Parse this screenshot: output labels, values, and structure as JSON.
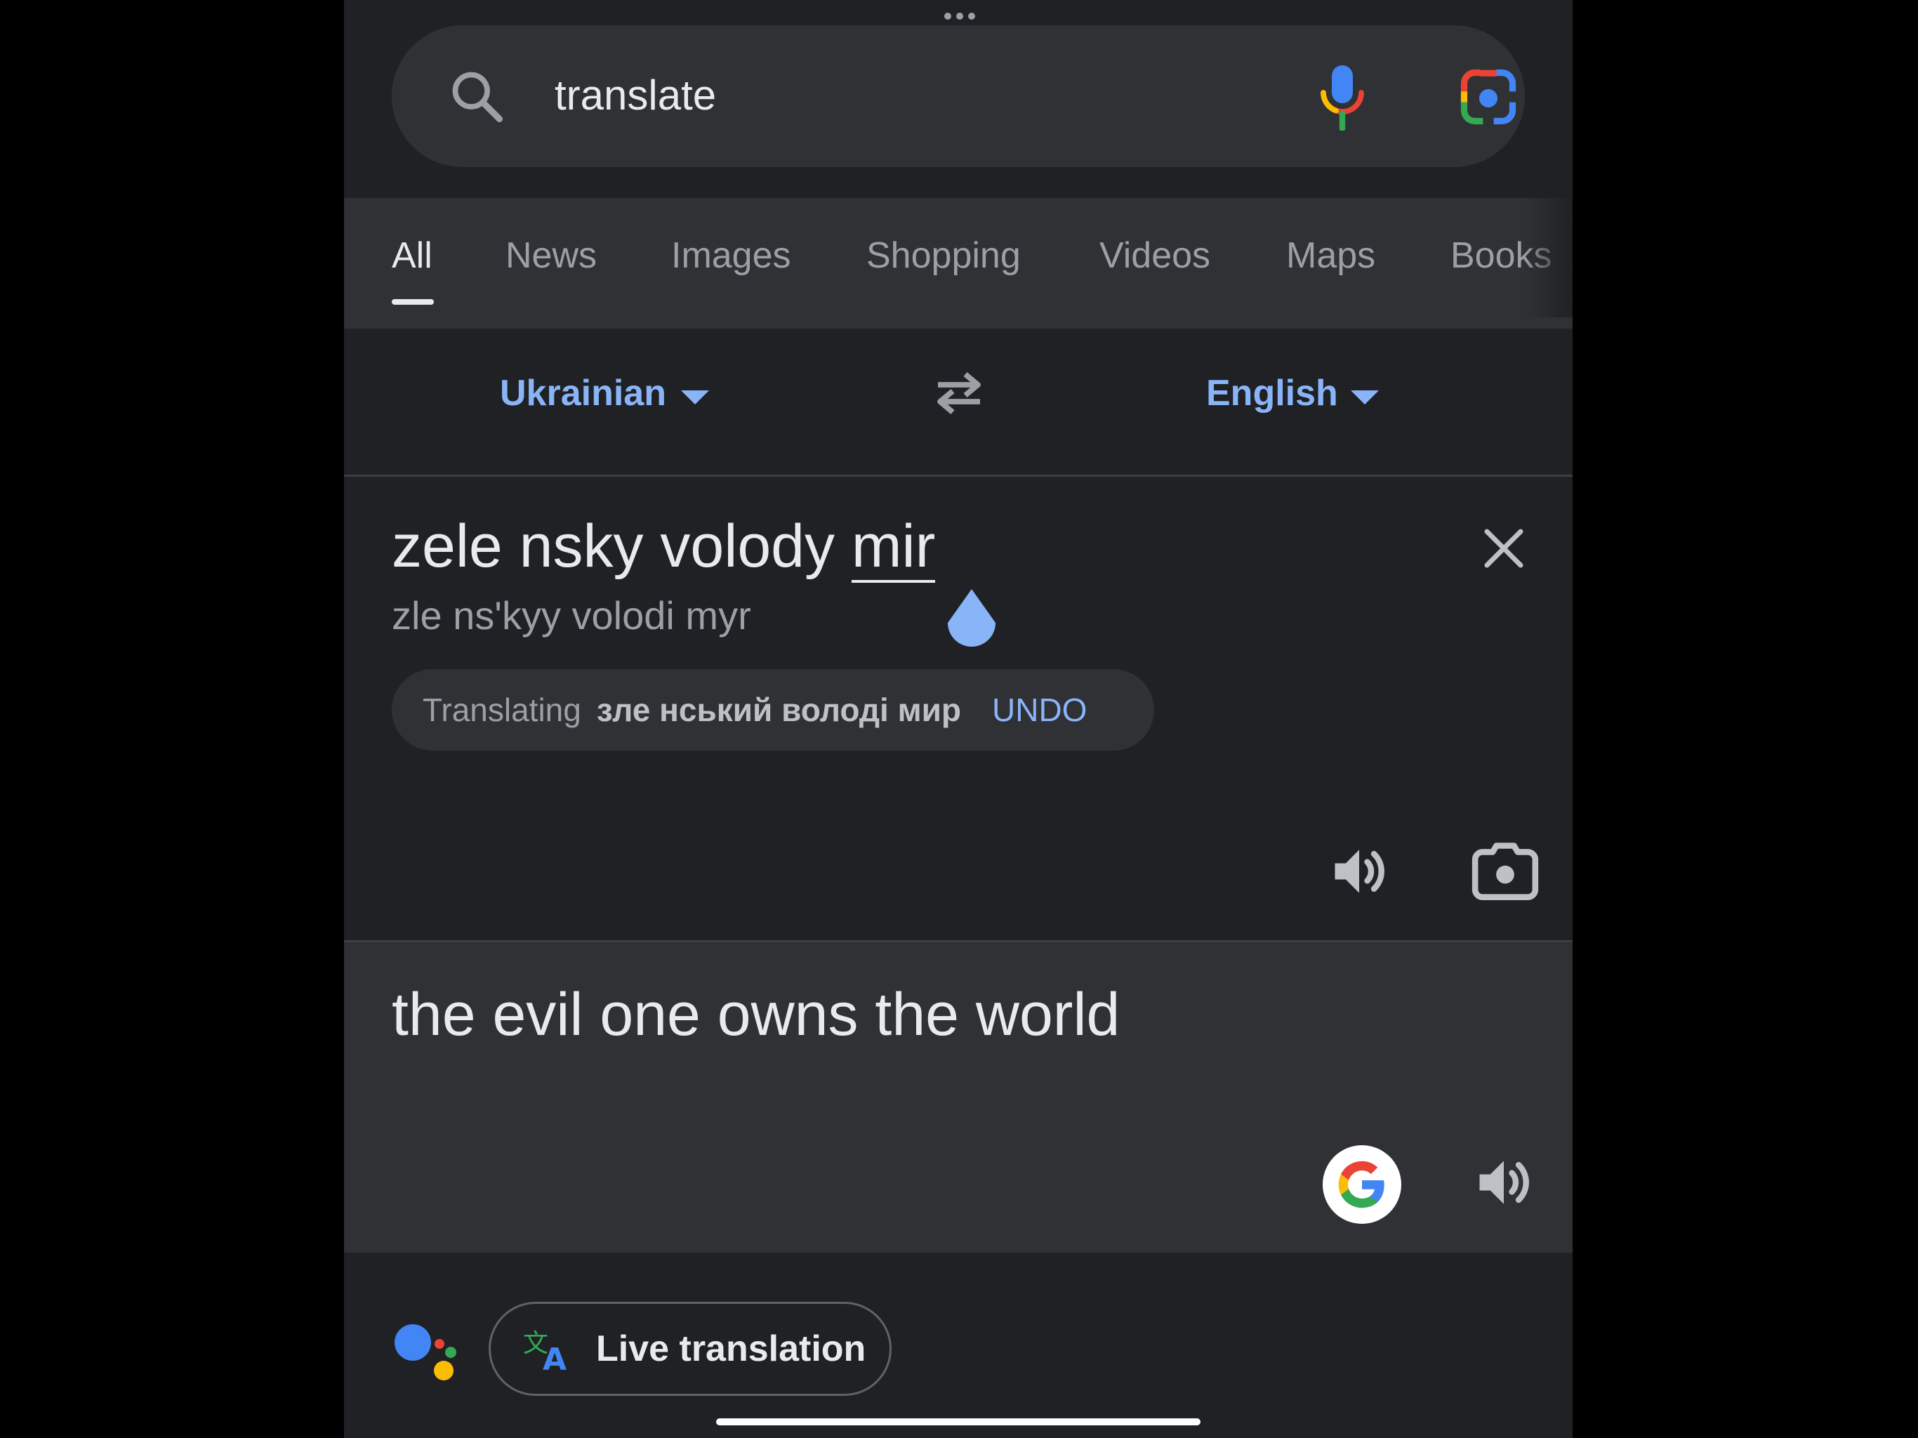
{
  "search": {
    "query": "translate"
  },
  "tabs": [
    {
      "label": "All",
      "active": true
    },
    {
      "label": "News"
    },
    {
      "label": "Images"
    },
    {
      "label": "Shopping"
    },
    {
      "label": "Videos"
    },
    {
      "label": "Maps"
    },
    {
      "label": "Books"
    }
  ],
  "translator": {
    "source_language": "Ukrainian",
    "target_language": "English",
    "source_text_before": "zele nsky volody ",
    "source_text_selected": "mir",
    "transliteration": "zle nsʹkyy volodi myr",
    "suggestion": {
      "label": "Translating",
      "query": "зле нський володі мир",
      "action": "UNDO"
    },
    "result_text": "the evil one owns the world"
  },
  "bottom": {
    "live_translation_label": "Live translation"
  },
  "colors": {
    "background": "#202124",
    "surface": "#303134",
    "accent": "#8ab4f8",
    "text_primary": "#e8eaed",
    "text_secondary": "#9aa0a6"
  },
  "icons": {
    "search": "search-icon",
    "mic": "microphone-icon",
    "lens": "google-lens-icon",
    "swap": "swap-arrows-icon",
    "close": "close-icon",
    "speaker": "speaker-icon",
    "camera": "camera-icon",
    "google": "google-g-icon",
    "assistant": "google-assistant-icon",
    "translate": "translate-icon"
  }
}
